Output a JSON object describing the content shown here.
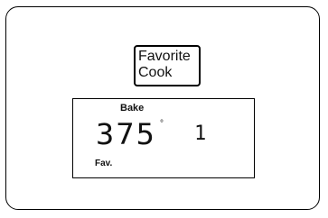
{
  "favorite_button": {
    "line1": "Favorite",
    "line2": "Cook"
  },
  "display": {
    "mode": "Bake",
    "temperature": "375",
    "degree_symbol": "°",
    "count": "1",
    "favorite_indicator": "Fav."
  }
}
